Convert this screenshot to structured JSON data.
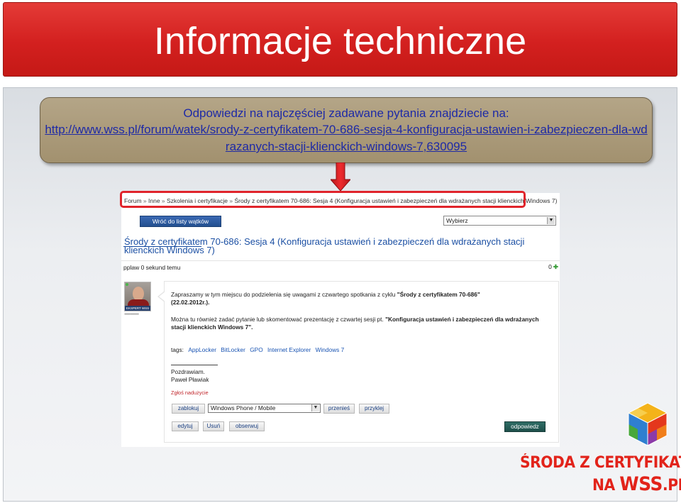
{
  "slide": {
    "title": "Informacje techniczne"
  },
  "callout": {
    "line1": "Odpowiedzi na najczęściej zadawane pytania znajdziecie na:",
    "link": "http://www.wss.pl/forum/watek/srody-z-certyfikatem-70-686-sesja-4-konfiguracja-ustawien-i-zabezpieczen-dla-wdrazanych-stacji-klienckich-windows-7,630095"
  },
  "forum": {
    "breadcrumb": [
      "Forum",
      "Inne",
      "Szkolenia i certyfikacje",
      "Środy z certyfikatem 70-686: Sesja 4 (Konfiguracja ustawień i zabezpieczeń dla wdrażanych stacji klienckich Windows 7)"
    ],
    "breadcrumb_sep": " » ",
    "back_button": "Wróć do listy wątków",
    "top_select": "Wybierz",
    "thread_title": "Środy z certyfikatem 70-686: Sesja 4 (Konfiguracja ustawień i zabezpieczeń dla wdrażanych stacji klienckich Windows 7)",
    "meta_user": "pplaw 0 sekund temu",
    "meta_count": "0",
    "avatar_badge": "EKSPERT WSS",
    "post": {
      "p1_a": "Zapraszamy w tym miejscu do podzielenia się uwagami z czwartego spotkania z cyklu ",
      "p1_b": "\"Środy z certyfikatem 70-686\" (22.02.2012r.).",
      "p2_a": "Można tu również zadać pytanie lub skomentować prezentację z czwartej sesji pt. ",
      "p2_b": "\"Konfiguracja ustawień i zabezpieczeń dla wdrażanych stacji klienckich Windows 7\".",
      "tags_label": "tags:",
      "tags": [
        "AppLocker",
        "BitLocker",
        "GPO",
        "Internet Explorer",
        "Windows 7"
      ],
      "greeting": "Pozdrawiam.",
      "author": "Paweł Pławiak",
      "report": "Zgłoś nadużycie"
    },
    "actions": {
      "block": "zablokuj",
      "category_select": "Windows Phone / Mobile",
      "move": "przenieś",
      "attach": "przyklej",
      "edit": "edytuj",
      "delete": "Usuń",
      "watch": "obserwuj",
      "reply": "odpowiedz"
    }
  },
  "logo": {
    "line1": "ŚRODA Z CERTYFIKATEM",
    "line2_a": "NA ",
    "line2_b": "WSS",
    "line2_c": ".PL"
  },
  "colors": {
    "title_bar": "#d3201f",
    "callout": "#a99a7b",
    "link": "#1e2aa6",
    "forum_link": "#1b4fa3",
    "highlight_border": "#e0242b",
    "logo_red": "#e2231a"
  }
}
